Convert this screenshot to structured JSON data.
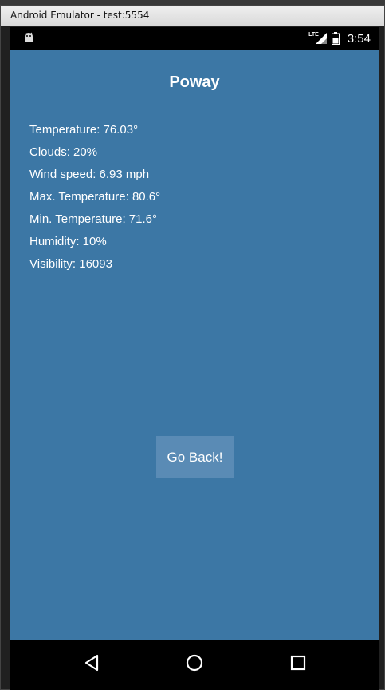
{
  "window": {
    "title": "Android Emulator - test:5554"
  },
  "status_bar": {
    "network_label": "LTE",
    "time": "3:54",
    "icons": [
      "android-icon",
      "signal-icon",
      "battery-icon"
    ]
  },
  "app": {
    "city": "Poway",
    "weather": [
      "Temperature: 76.03°",
      "Clouds: 20%",
      "Wind speed: 6.93 mph",
      "Max. Temperature: 80.6°",
      "Min. Temperature: 71.6°",
      "Humidity: 10%",
      "Visibility: 16093"
    ],
    "back_button_label": "Go Back!",
    "colors": {
      "background": "#3c77a5",
      "button": "#5a8bb5",
      "text": "#ffffff"
    }
  },
  "nav_bar": {
    "icons": [
      "back-triangle-icon",
      "home-circle-icon",
      "recents-square-icon"
    ]
  }
}
